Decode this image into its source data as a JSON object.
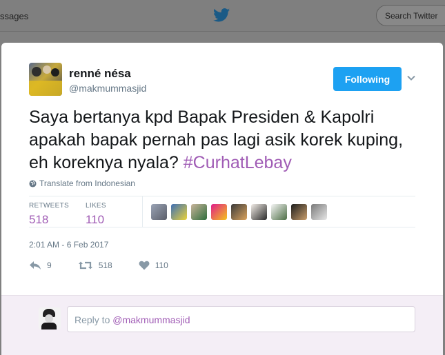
{
  "topbar": {
    "messages_label": "ssages",
    "search_placeholder": "Search Twitter"
  },
  "tweet": {
    "author_name": "renné nésa",
    "author_handle": "@makmummasjid",
    "follow_label": "Following",
    "text": "Saya bertanya kpd Bapak Presiden & Kapolri apakah bapak pernah pas lagi asik korek kuping, eh koreknya nyala? ",
    "hashtag": "#CurhatLebay",
    "translate_label": "Translate from Indonesian",
    "stats": {
      "retweets_label": "RETWEETS",
      "retweets_value": "518",
      "likes_label": "LIKES",
      "likes_value": "110"
    },
    "likers_count_shown": 9,
    "timestamp": "2:01 AM - 6 Feb 2017",
    "actions": {
      "reply_count": "9",
      "retweet_count": "518",
      "like_count": "110"
    }
  },
  "reply": {
    "prefix": "Reply to ",
    "mention": "@makmummasjid"
  },
  "colors": {
    "accent": "#1da1f2",
    "hashtag": "#a05cb5",
    "muted": "#657786",
    "reply_bg": "#f4eef6"
  },
  "icons": [
    "twitter-bird-icon",
    "chevron-down-icon",
    "globe-icon",
    "reply-icon",
    "retweet-icon",
    "heart-icon"
  ]
}
